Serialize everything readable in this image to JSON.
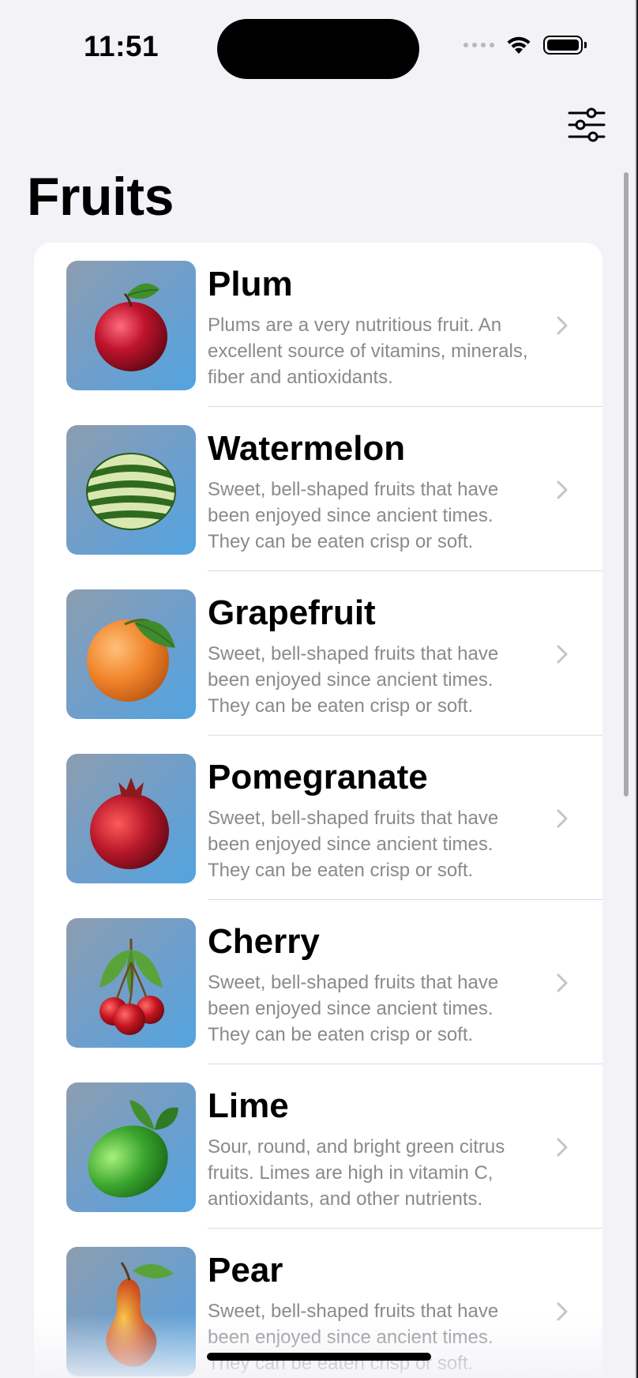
{
  "status_bar": {
    "time": "11:51"
  },
  "nav": {
    "title": "Fruits",
    "filter_icon": "sliders-icon"
  },
  "fruits": [
    {
      "name": "Plum",
      "description": "Plums are a very nutritious fruit. An excellent source of vitamins, minerals, fiber and antioxidants.",
      "color": "#b3122b"
    },
    {
      "name": "Watermelon",
      "description": "Sweet, bell-shaped fruits that have been enjoyed since ancient times. They can be eaten crisp or soft.",
      "color": "#3e7d2a"
    },
    {
      "name": "Grapefruit",
      "description": "Sweet, bell-shaped fruits that have been enjoyed since ancient times. They can be eaten crisp or soft.",
      "color": "#f08a2e"
    },
    {
      "name": "Pomegranate",
      "description": "Sweet, bell-shaped fruits that have been enjoyed since ancient times. They can be eaten crisp or soft.",
      "color": "#b81d2a"
    },
    {
      "name": "Cherry",
      "description": "Sweet, bell-shaped fruits that have been enjoyed since ancient times. They can be eaten crisp or soft.",
      "color": "#c4151f"
    },
    {
      "name": "Lime",
      "description": "Sour, round, and bright green citrus fruits. Limes are high in vitamin C, antioxidants, and other nutrients.",
      "color": "#3fae34"
    },
    {
      "name": "Pear",
      "description": "Sweet, bell-shaped fruits that have been enjoyed since ancient times. They can be eaten crisp or soft.",
      "color": "#c8431f"
    }
  ]
}
